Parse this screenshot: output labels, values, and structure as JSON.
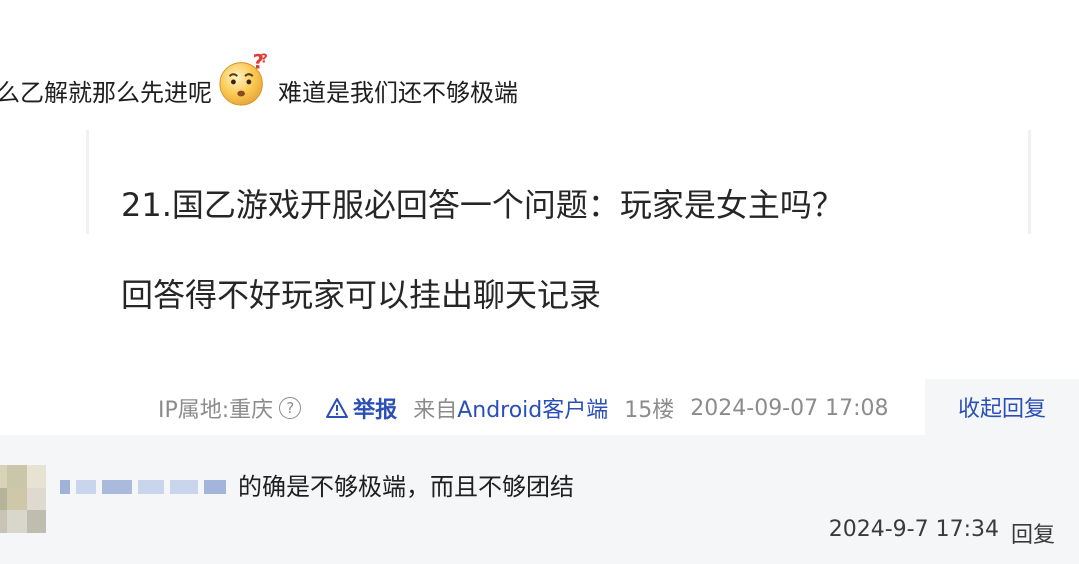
{
  "post": {
    "text_before_emoji": "么乙解就那么先进呢",
    "emoji": "thinking-face-emoji",
    "text_after_emoji": "难道是我们还不够极端"
  },
  "quote": {
    "line1": "21.国乙游戏开服必回答一个问题：玩家是女主吗？",
    "line2": "回答得不好玩家可以挂出聊天记录"
  },
  "meta": {
    "ip": "IP属地:重庆",
    "help": "?",
    "report": "举报",
    "from_prefix": "来自",
    "client": "Android客户端",
    "floor": "15楼",
    "time": "2024-09-07 17:08",
    "collapse_reply": "收起回复"
  },
  "reply": {
    "text": "的确是不够极端，而且不够团结",
    "time": "2024-9-7 17:34",
    "reply_label": "回复"
  },
  "colors": {
    "link": "#2b4fb8",
    "meta_gray": "#8c8c8c",
    "reply_bg": "#f5f6f8"
  }
}
